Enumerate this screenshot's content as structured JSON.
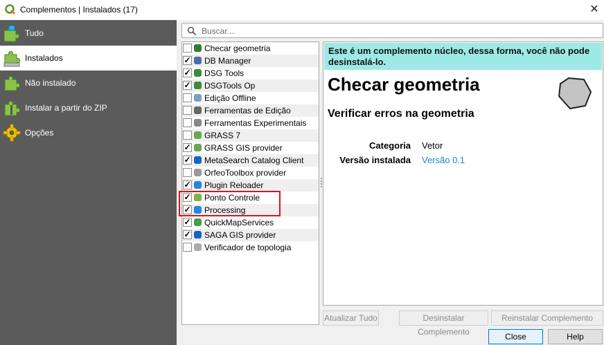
{
  "window": {
    "title": "Complementos | Instalados (17)",
    "close_glyph": "✕"
  },
  "sidebar": {
    "items": [
      {
        "label": "Tudo",
        "icon": "puzzle-all-icon",
        "selected": false
      },
      {
        "label": "Instalados",
        "icon": "puzzle-installed-icon",
        "selected": true
      },
      {
        "label": "Não instalado",
        "icon": "puzzle-not-installed-icon",
        "selected": false
      },
      {
        "label": "Instalar a partir do ZIP",
        "icon": "puzzle-zip-icon",
        "selected": false
      },
      {
        "label": "Opções",
        "icon": "gear-icon",
        "selected": false
      }
    ]
  },
  "search": {
    "placeholder": "Buscar..."
  },
  "plugins": [
    {
      "name": "Checar geometria",
      "checked": false
    },
    {
      "name": "DB Manager",
      "checked": true
    },
    {
      "name": "DSG Tools",
      "checked": true
    },
    {
      "name": "DSGTools Op",
      "checked": true
    },
    {
      "name": "Edição Offline",
      "checked": false
    },
    {
      "name": "Ferramentas de Edição",
      "checked": false
    },
    {
      "name": "Ferramentas Experimentais",
      "checked": false
    },
    {
      "name": "GRASS 7",
      "checked": false
    },
    {
      "name": "GRASS GIS provider",
      "checked": true
    },
    {
      "name": "MetaSearch Catalog Client",
      "checked": true
    },
    {
      "name": "OrfeoToolbox provider",
      "checked": false
    },
    {
      "name": "Plugin Reloader",
      "checked": true
    },
    {
      "name": "Ponto Controle",
      "checked": true
    },
    {
      "name": "Processing",
      "checked": true
    },
    {
      "name": "QuickMapServices",
      "checked": true
    },
    {
      "name": "SAGA GIS provider",
      "checked": true
    },
    {
      "name": "Verificador de topologia",
      "checked": false
    }
  ],
  "detail": {
    "notice": "Este é um complemento núcleo, dessa forma, você não pode desinstalá-lo.",
    "title": "Checar geometria",
    "subtitle": "Verificar erros na geometria",
    "category_label": "Categoria",
    "category_value": "Vetor",
    "version_label": "Versão instalada",
    "version_value": "Versão 0.1"
  },
  "buttons": {
    "update_all": "Atualizar Tudo",
    "uninstall": "Desinstalar Complemento",
    "reinstall": "Reinstalar Complemento",
    "close": "Close",
    "help": "Help"
  },
  "colors": {
    "sidebar_bg": "#5b5b5b",
    "notice_bg": "#9de9e5",
    "highlight": "#e0111b",
    "link": "#1a86c8"
  }
}
